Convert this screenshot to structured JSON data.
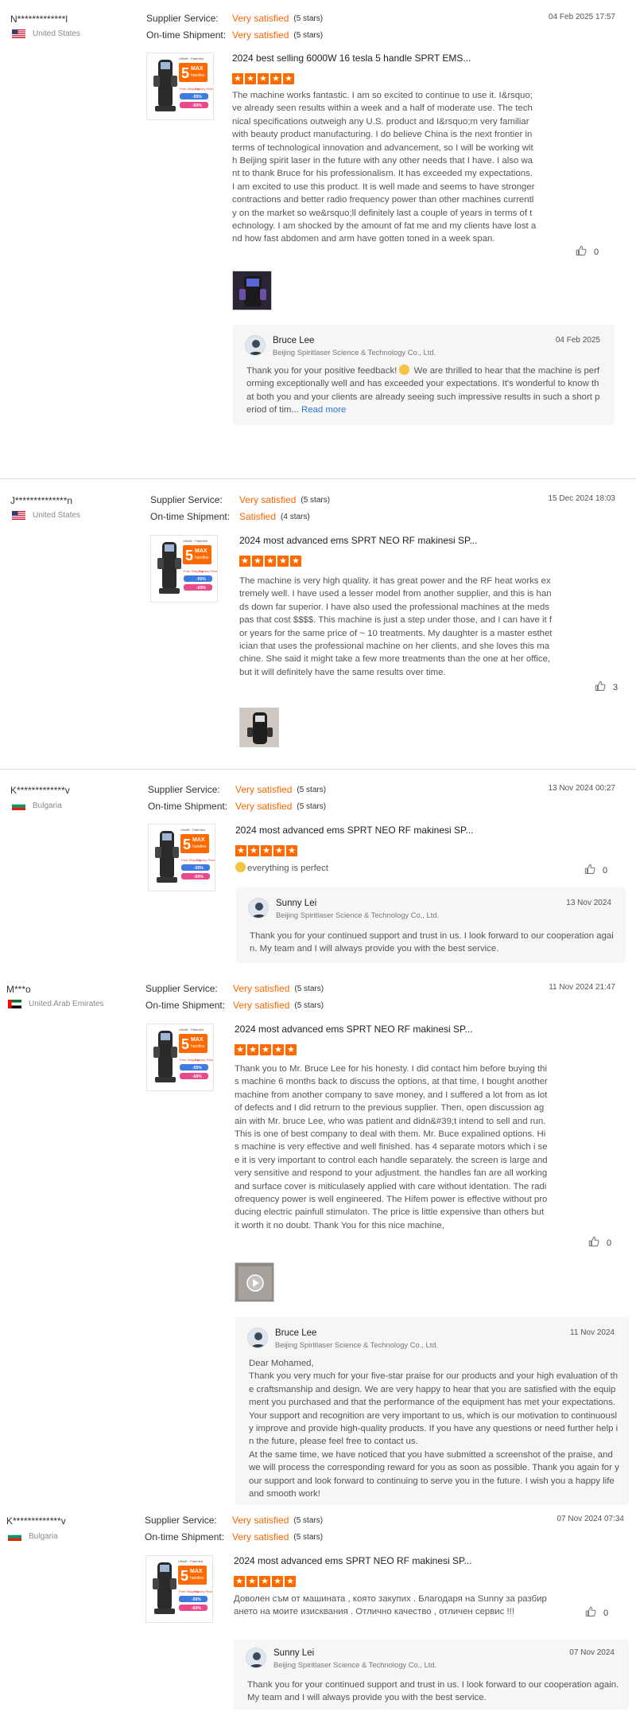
{
  "labels": {
    "supplier_service": "Supplier Service:",
    "on_time_shipment": "On-time Shipment:",
    "read_more": "Read more"
  },
  "colors": {
    "accent": "#ff6600",
    "link": "#2b79d6",
    "reply_bg": "#f6f6f6"
  },
  "reviews": [
    {
      "buyer": "N*************l",
      "country": "United States",
      "flag": "us-flag-icon",
      "supplier_service": "Very satisfied",
      "supplier_stars": "(5 stars)",
      "shipment": "Very satisfied",
      "shipment_stars": "(5 stars)",
      "date": "04 Feb 2025 17:57",
      "product": "2024 best selling 6000W 16 tesla 5 handle SPRT EMS...",
      "rating": 5,
      "text": "The machine works fantastic. I am so excited to continue to use it. I&rsquo;ve already seen results within a week and a half of moderate use. The technical specifications outweigh any U.S. product and I&rsquo;m very familiar with beauty product manufacturing. I do believe China is the next frontier in terms of technological innovation and advancement, so I will be working with Beijing spirit laser in the future with any other needs that I have. I also want to thank Bruce for his professionalism. It has exceeded my expectations. I am excited to use this product. It is well made and seems to have stronger contractions and better radio frequency power than other machines currently on the market so we&rsquo;ll definitely last a couple of years in terms of technology. I am shocked by the amount of fat me and my clients have lost and how fast abdomen and arm have gotten toned in a week span.",
      "likes": "0",
      "reply": {
        "name": "Bruce Lee",
        "company": "Beijing Spiritlaser Science & Technology Co., Ltd.",
        "date": "04 Feb 2025",
        "text_before": "Thank you for your positive feedback! ",
        "text": " We are thrilled to hear that the machine is performing exceptionally well and has exceeded your expectations. It's wonderful to know that both you and your clients are already seeing such impressive results in such a short period of tim..."
      }
    },
    {
      "buyer": "J**************n",
      "country": "United States",
      "flag": "us-flag-icon",
      "supplier_service": "Very satisfied",
      "supplier_stars": "(5 stars)",
      "shipment": "Satisfied",
      "shipment_stars": "(4 stars)",
      "date": "15 Dec 2024 18:03",
      "product": "2024 most advanced ems SPRT NEO RF makinesi SP...",
      "rating": 5,
      "text": "The machine is very high quality. it has great power and the RF heat works extremely well. I have used a lesser model from another supplier, and this is hands down far superior. I have also used the professional machines at the medspas that cost $$$$. This machine is just a step under those, and I can have it for years for the same price of ~ 10 treatments. My daughter is a master esthetician that uses the professional machine on her clients, and she loves this machine. She said it might take a few more treatments than the one at her office, but it will definitely have the same results over time.",
      "likes": "3"
    },
    {
      "buyer": "K*************v",
      "country": "Bulgaria",
      "flag": "bulgaria-flag-icon",
      "supplier_service": "Very satisfied",
      "supplier_stars": "(5 stars)",
      "shipment": "Very satisfied",
      "shipment_stars": "(5 stars)",
      "date": "13 Nov 2024 00:27",
      "product": "2024 most advanced ems SPRT NEO RF makinesi SP...",
      "rating": 5,
      "text": "everything is perfect",
      "likes": "0",
      "reply": {
        "name": "Sunny Lei",
        "company": "Beijing Spiritlaser Science & Technology Co., Ltd.",
        "date": "13 Nov 2024",
        "text": "Thank you for your continued support and trust in us. I look forward to our cooperation again. My team and I will always provide you with the best service."
      }
    },
    {
      "buyer": "M***o",
      "country": "United Arab Emirates",
      "flag": "uae-flag-icon",
      "supplier_service": "Very satisfied",
      "supplier_stars": "(5 stars)",
      "shipment": "Very satisfied",
      "shipment_stars": "(5 stars)",
      "date": "11 Nov 2024 21:47",
      "product": "2024 most advanced ems SPRT NEO RF makinesi SP...",
      "rating": 5,
      "text": "Thank you to Mr. Bruce Lee for his honesty. I did contact him before buying this machine 6 months back to discuss the options, at that time, I bought another machine from another company to save money, and I suffered a lot from as lot of defects and I did retrurn to the previous supplier. Then, open discussion again with Mr. bruce Lee, who was patient and didn&#39;t intend to sell and run. This is one of best company to deal with them. Mr. Buce expalined options. His machine is very effective and well finished. has 4 separate motors which i see it is very important to control each handle separately. the screen is large and very sensitive and respond to your adjustment. the handles fan are all working and surface cover is miticulasely applied with care without identation. The radiofrequency power is well engineered. The Hifem power is effective without producing electric painfull stimulaton. The price is little expensive than others but it worth it no doubt. Thank You for this nice machine,",
      "likes": "0",
      "reply": {
        "name": "Bruce Lee",
        "company": "Beijing Spiritlaser Science & Technology Co., Ltd.",
        "date": "11 Nov 2024",
        "greeting": "Dear Mohamed,",
        "text": "Thank you very much for your five-star praise for our products and your high evaluation of the craftsmanship and design. We are very happy to hear that you are satisfied with the equipment you purchased and that the performance of the equipment has met your expectations. Your support and recognition are very important to us, which is our motivation to continuously improve and provide high-quality products. If you have any questions or need further help in the future, please feel free to contact us.",
        "text2": "At the same time, we have noticed that you have submitted a screenshot of the praise, and we will process the corresponding reward for you as soon as possible. Thank you again for your support and look forward to continuing to serve you in the future. I wish you a happy life and smooth work!"
      }
    },
    {
      "buyer": "K*************v",
      "country": "Bulgaria",
      "flag": "bulgaria-flag-icon",
      "supplier_service": "Very satisfied",
      "supplier_stars": "(5 stars)",
      "shipment": "Very satisfied",
      "shipment_stars": "(5 stars)",
      "date": "07 Nov 2024 07:34",
      "product": "2024 most advanced ems SPRT NEO RF makinesi SP...",
      "rating": 5,
      "text": "Доволен съм от машината , която закупих . Благодаря на Sunny за разбирането на моите изисквания . Отлично качество , отличен сервис !!!",
      "likes": "0",
      "reply": {
        "name": "Sunny Lei",
        "company": "Beijing Spiritlaser Science & Technology Co., Ltd.",
        "date": "07 Nov 2024",
        "text": "Thank you for your continued support and trust in us. I look forward to our cooperation again. My team and I will always provide you with the best service."
      }
    }
  ],
  "thumbnail": {
    "brand": "Ultrafit · Patented",
    "badge_big": "5",
    "badge_small": "MAX",
    "badge_sub": "handles",
    "tag1": "Free Shipping",
    "tag2": "Factory Price",
    "off1": "-55%",
    "off2": "-60%"
  }
}
